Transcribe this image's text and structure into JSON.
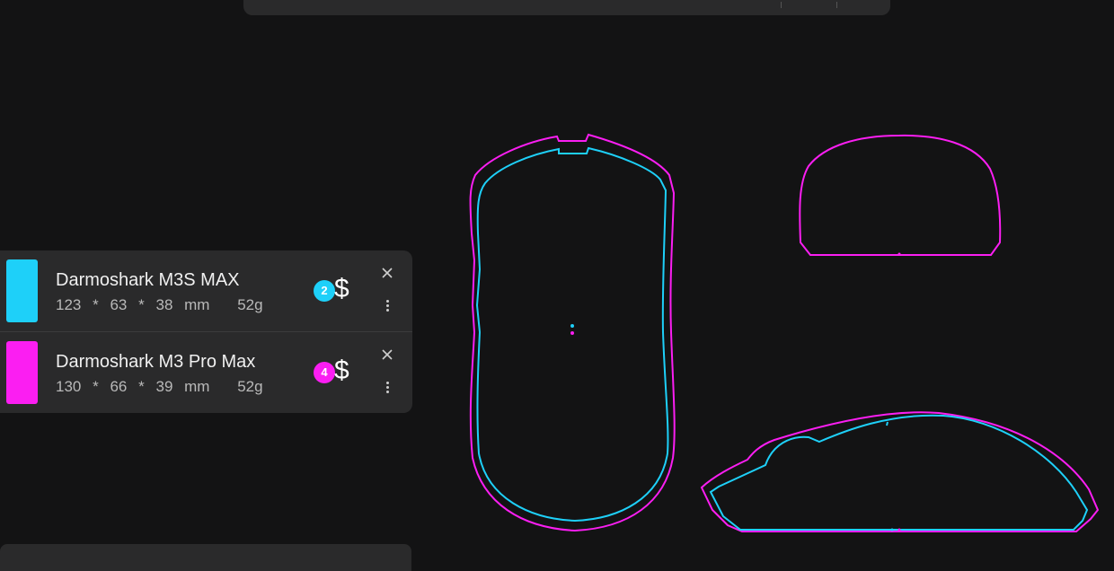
{
  "colors": {
    "mouse_1": "#1ed0f9",
    "mouse_2": "#fb1ef2",
    "background": "#131314",
    "panel": "#2a2a2b"
  },
  "mice": [
    {
      "name": "Darmoshark M3S MAX",
      "length": "123",
      "width": "63",
      "height": "38",
      "unit": "mm",
      "weight": "52g",
      "price_tier": "2",
      "price_icon": "$",
      "color": "#1ed0f9"
    },
    {
      "name": "Darmoshark M3 Pro Max",
      "length": "130",
      "width": "66",
      "height": "39",
      "unit": "mm",
      "weight": "52g",
      "price_tier": "4",
      "price_icon": "$",
      "color": "#fb1ef2"
    }
  ],
  "dims_separator": "*",
  "icons": {
    "close": "close-icon",
    "more": "more-vert-icon",
    "price": "dollar-icon"
  },
  "views": [
    "top-view",
    "front-view",
    "side-view"
  ]
}
